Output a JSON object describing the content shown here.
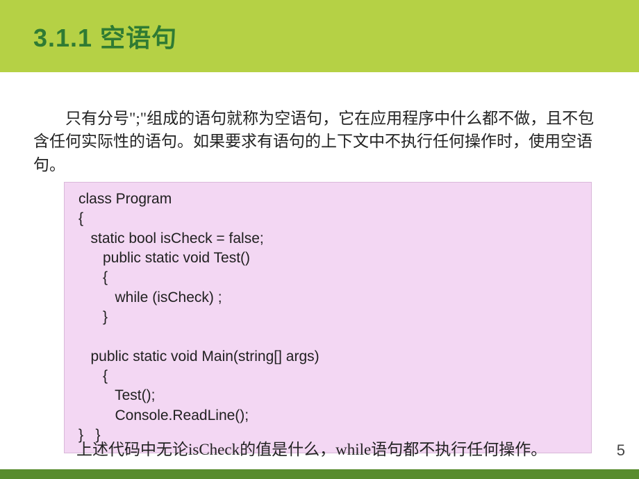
{
  "slide": {
    "title": "3.1.1  空语句",
    "paragraph": "只有分号\";\"组成的语句就称为空语句，它在应用程序中什么都不做，且不包含任何实际性的语句。如果要求有语句的上下文中不执行任何操作时，使用空语句。",
    "code": "class Program\n{\n   static bool isCheck = false;\n      public static void Test()\n      {\n         while (isCheck) ;\n      }\n\n   public static void Main(string[] args)\n      {\n         Test();\n         Console.ReadLine();\n}   }",
    "footer": "上述代码中无论isCheck的值是什么，while语句都不执行任何操作。",
    "pageNumber": "5"
  }
}
